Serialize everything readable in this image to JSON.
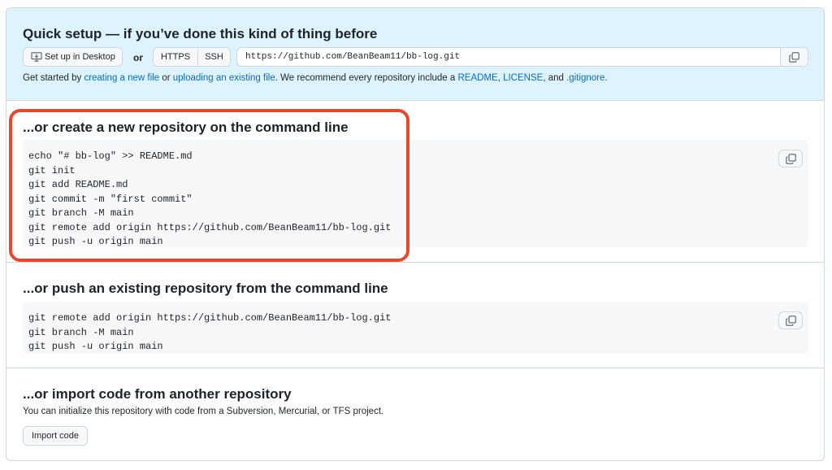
{
  "quick_setup": {
    "title": "Quick setup — if you’ve done this kind of thing before",
    "desktop_button": "Set up in Desktop",
    "or_text": "or",
    "https_label": "HTTPS",
    "ssh_label": "SSH",
    "url": "https://github.com/BeanBeam11/bb-log.git",
    "get_started": {
      "prefix": "Get started by ",
      "link_new_file": "creating a new file",
      "mid1": " or ",
      "link_upload": "uploading an existing file",
      "mid2": ". We recommend every repository include a ",
      "link_readme": "README",
      "mid3": ", ",
      "link_license": "LICENSE",
      "mid4": ", and ",
      "link_gitignore": ".gitignore",
      "suffix": "."
    }
  },
  "create_section": {
    "title": "...or create a new repository on the command line",
    "lines": [
      "echo \"# bb-log\" >> README.md",
      "git init",
      "git add README.md",
      "git commit -m \"first commit\"",
      "git branch -M main",
      "git remote add origin https://github.com/BeanBeam11/bb-log.git",
      "git push -u origin main"
    ]
  },
  "push_section": {
    "title": "...or push an existing repository from the command line",
    "lines": [
      "git remote add origin https://github.com/BeanBeam11/bb-log.git",
      "git branch -M main",
      "git push -u origin main"
    ]
  },
  "import_section": {
    "title": "...or import code from another repository",
    "description": "You can initialize this repository with code from a Subversion, Mercurial, or TFS project.",
    "button": "Import code"
  },
  "icons": {
    "desktop": "desktop-download-icon",
    "copy": "copy-icon"
  },
  "colors": {
    "quick_bg": "#ddf4ff",
    "link": "#0969da",
    "highlight": "#e8472a"
  }
}
